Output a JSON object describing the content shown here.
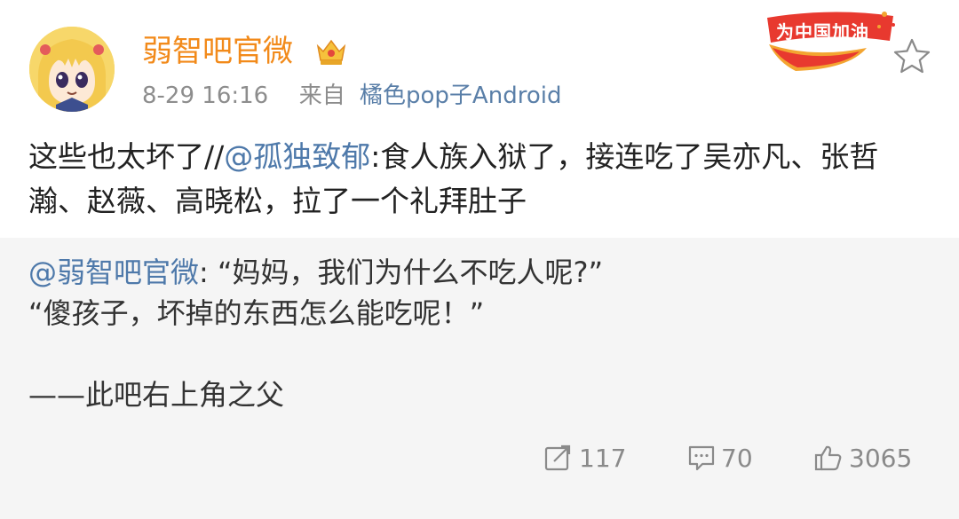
{
  "post": {
    "username": "弱智吧官微",
    "timestamp": "8-29 16:16",
    "source_prefix": "来自",
    "source": "橘色pop子Android",
    "badge_text": "为中国加油",
    "content_before": "这些也太坏了//",
    "mention": "@孤独致郁",
    "content_after": ":食人族入狱了，接连吃了吴亦凡、张哲瀚、赵薇、高晓松，拉了一个礼拜肚子"
  },
  "repost": {
    "mention": "@弱智吧官微",
    "line1_after": ": “妈妈，我们为什么不吃人呢?”",
    "line2": "“傻孩子，坏掉的东西怎么能吃呢！”",
    "line3": "——此吧右上角之父"
  },
  "actions": {
    "repost_count": "117",
    "comment_count": "70",
    "like_count": "3065"
  },
  "colors": {
    "username": "#f28a1a",
    "mention": "#4e79aa",
    "repost_bg": "#f5f5f5"
  }
}
